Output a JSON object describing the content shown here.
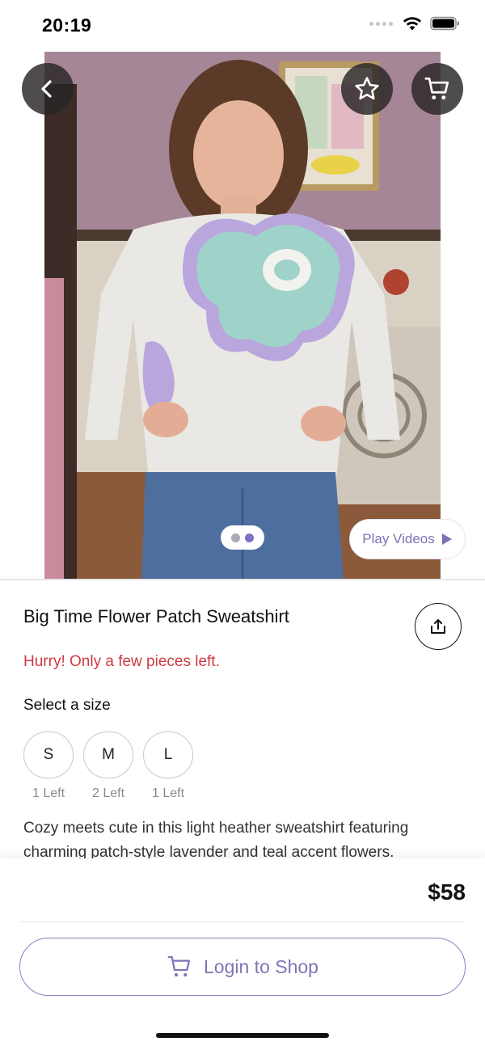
{
  "status_bar": {
    "time": "20:19"
  },
  "product": {
    "title": "Big Time Flower Patch Sweatshirt",
    "stock_warning": "Hurry! Only a few pieces left.",
    "size_prompt": "Select a size",
    "sizes": [
      {
        "label": "S",
        "left": "1 Left"
      },
      {
        "label": "M",
        "left": "2 Left"
      },
      {
        "label": "L",
        "left": "1 Left"
      }
    ],
    "description": "Cozy meets cute in this light heather sweatshirt featuring charming patch-style lavender and teal accent flowers.",
    "price": "$58"
  },
  "media": {
    "play_videos_label": "Play Videos",
    "carousel_page_count": 2,
    "carousel_active_index": 1,
    "icons": [
      "back-chevron-icon",
      "star-icon",
      "cart-icon",
      "play-icon",
      "share-icon"
    ]
  },
  "cta": {
    "login_label": "Login to Shop",
    "icon": "cart-icon"
  },
  "colors": {
    "accent": "#7d76b8",
    "warning": "#cf3a44",
    "overlay_button": "#282426",
    "dot_inactive": "#a9a9ba",
    "dot_active": "#7a72c4"
  }
}
